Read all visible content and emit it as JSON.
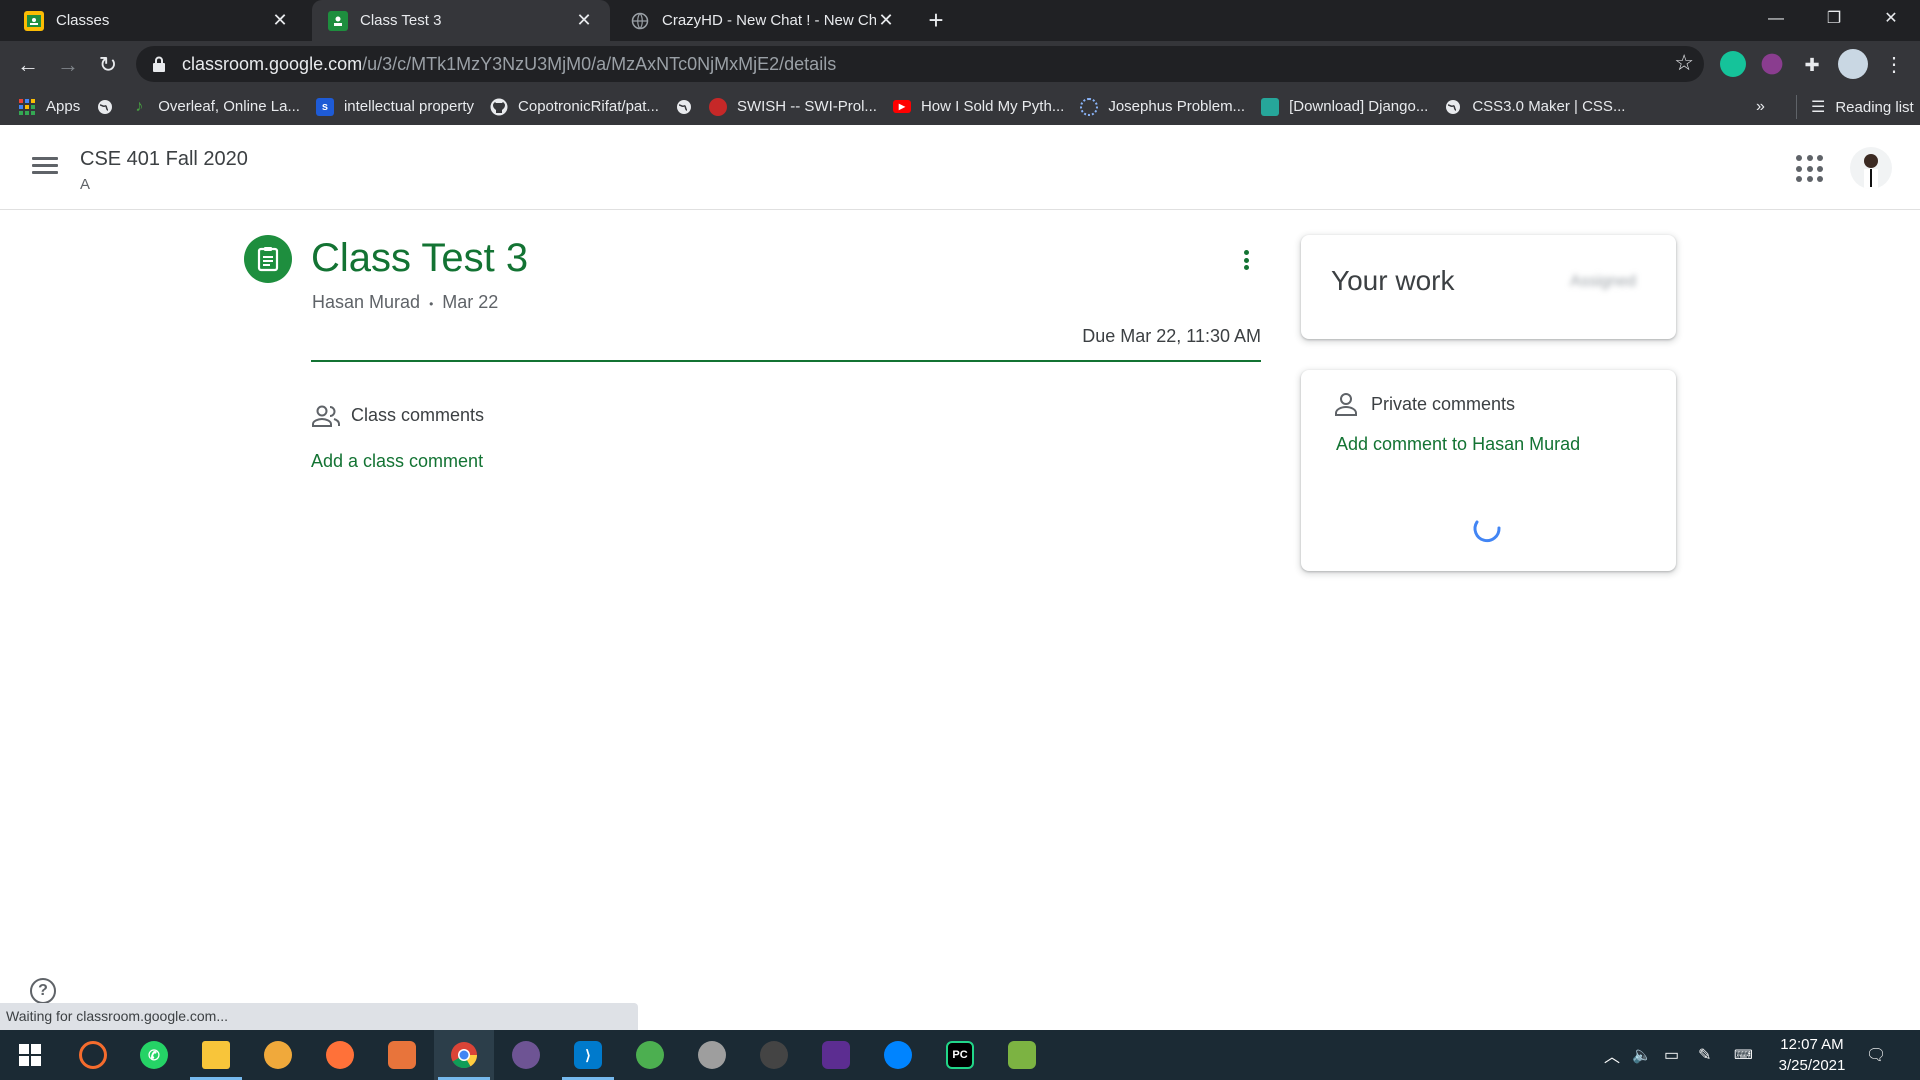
{
  "browser": {
    "tabs": [
      {
        "title": "Classes",
        "active": false,
        "favicon_color": "#fbbc04"
      },
      {
        "title": "Class Test 3",
        "active": true,
        "favicon_color": "#1e8e3e"
      },
      {
        "title": "CrazyHD - New Chat ! - New Cha",
        "active": false,
        "favicon_color": "#5f6368"
      }
    ],
    "url_host": "classroom.google.com",
    "url_path": "/u/3/c/MTk1MzY3NzU3MjM0/a/MzAxNTc0NjMxMjE2/details",
    "window_controls": [
      "minimize-icon",
      "restore-icon",
      "close-icon"
    ]
  },
  "bookmarks": {
    "items": [
      {
        "label": "Apps",
        "icon": "apps-grid-icon",
        "color": "#4285f4"
      },
      {
        "label": "",
        "icon": "globe-icon",
        "color": "#e8eaed"
      },
      {
        "label": "Overleaf, Online La...",
        "icon": "overleaf-icon",
        "color": "#47a141"
      },
      {
        "label": "intellectual property",
        "icon": "scribd-icon",
        "color": "#1e5bd6"
      },
      {
        "label": "CopotronicRifat/pat...",
        "icon": "github-icon",
        "color": "#e8eaed"
      },
      {
        "label": "",
        "icon": "globe-icon",
        "color": "#e8eaed"
      },
      {
        "label": "SWISH -- SWI-Prol...",
        "icon": "swish-icon",
        "color": "#c62828"
      },
      {
        "label": "How I Sold My Pyth...",
        "icon": "youtube-icon",
        "color": "#ff0000"
      },
      {
        "label": "Josephus Problem...",
        "icon": "loading-icon",
        "color": "#8ab4f8"
      },
      {
        "label": "[Download] Django...",
        "icon": "django-icon",
        "color": "#26a69a"
      },
      {
        "label": "CSS3.0 Maker | CSS...",
        "icon": "globe-icon",
        "color": "#e8eaed"
      }
    ],
    "more": "»",
    "reading_list": "Reading list"
  },
  "classroom": {
    "course_title": "CSE 401 Fall 2020",
    "course_section": "A"
  },
  "assignment": {
    "title": "Class Test 3",
    "author": "Hasan Murad",
    "date": "Mar 22",
    "separator": "•",
    "due": "Due Mar 22, 11:30 AM",
    "class_comments_label": "Class comments",
    "add_class_comment": "Add a class comment"
  },
  "your_work": {
    "title": "Your work",
    "status": "Assigned"
  },
  "private_comments": {
    "label": "Private comments",
    "add": "Add comment to Hasan Murad"
  },
  "status_bar": "Waiting for classroom.google.com...",
  "taskbar": {
    "time": "12:07 AM",
    "date": "3/25/2021",
    "apps": [
      {
        "name": "start",
        "color": "#ffffff"
      },
      {
        "name": "origin",
        "color": "#f56c2d"
      },
      {
        "name": "whatsapp",
        "color": "#25d366"
      },
      {
        "name": "file-explorer",
        "color": "#f8c53a"
      },
      {
        "name": "brave",
        "color": "#f0a93b"
      },
      {
        "name": "firefox",
        "color": "#ff7139"
      },
      {
        "name": "matlab",
        "color": "#e8743b"
      },
      {
        "name": "chrome",
        "color": "#4285f4"
      },
      {
        "name": "github-desktop",
        "color": "#6e5494"
      },
      {
        "name": "vscode",
        "color": "#007acc"
      },
      {
        "name": "app-green",
        "color": "#4caf50"
      },
      {
        "name": "app-brain",
        "color": "#9e9e9e"
      },
      {
        "name": "inkscape",
        "color": "#888888"
      },
      {
        "name": "visual-studio",
        "color": "#5c2d91"
      },
      {
        "name": "messenger",
        "color": "#0084ff"
      },
      {
        "name": "pycharm",
        "color": "#21d789"
      },
      {
        "name": "app-notepad",
        "color": "#7cb342"
      }
    ]
  }
}
